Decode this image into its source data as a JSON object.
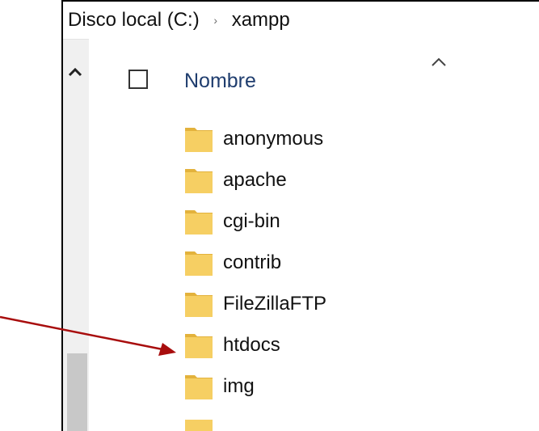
{
  "breadcrumb": {
    "items": [
      "Disco local (C:)",
      "xampp"
    ],
    "separator": "›"
  },
  "column_header": {
    "name_label": "Nombre",
    "sort_icon": "chevron-up-icon",
    "sort_direction": "ascending"
  },
  "files": [
    {
      "name": "anonymous",
      "type": "folder"
    },
    {
      "name": "apache",
      "type": "folder"
    },
    {
      "name": "cgi-bin",
      "type": "folder"
    },
    {
      "name": "contrib",
      "type": "folder"
    },
    {
      "name": "FileZillaFTP",
      "type": "folder"
    },
    {
      "name": "htdocs",
      "type": "folder"
    },
    {
      "name": "img",
      "type": "folder"
    }
  ],
  "annotation": {
    "type": "arrow",
    "color": "#a80d0d",
    "target": "htdocs"
  },
  "colors": {
    "folder": "#f6cf63",
    "folder_dark": "#e3b23c",
    "header_text": "#1f3d6e",
    "nav_pane": "#f0f0f0"
  }
}
